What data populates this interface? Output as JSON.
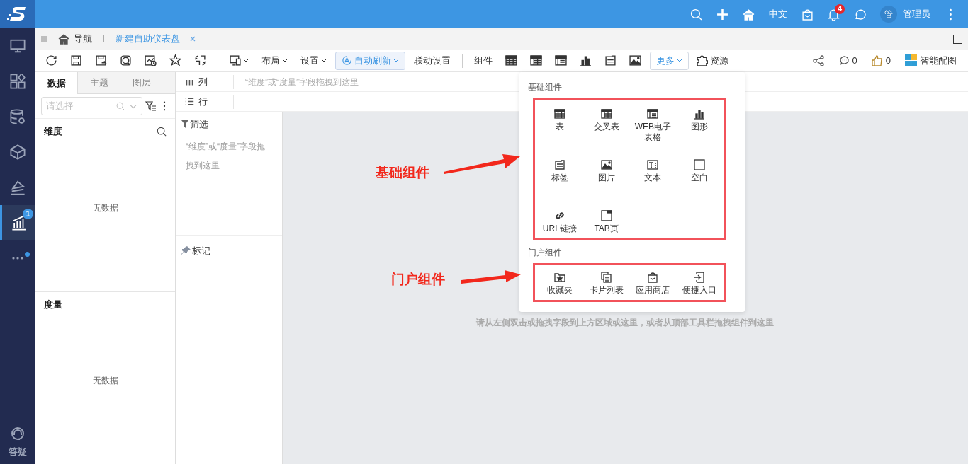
{
  "top_bar": {
    "items": [
      {
        "kind": "icon"
      },
      {
        "kind": "icon"
      },
      {
        "kind": "icon"
      },
      {
        "kind": "text",
        "label": "中文"
      },
      {
        "kind": "icon"
      },
      {
        "kind": "icon",
        "badge": "4"
      },
      {
        "kind": "icon"
      },
      {
        "kind": "avatar",
        "label": "管"
      },
      {
        "kind": "text",
        "label": "管理员"
      },
      {
        "kind": "icon"
      }
    ]
  },
  "sidebar": {
    "items": [
      {
        "selected": false
      },
      {
        "selected": false
      },
      {
        "selected": false
      },
      {
        "selected": false
      },
      {
        "selected": false
      },
      {
        "selected": true,
        "badge": "1"
      },
      {
        "selected": false,
        "dot": true
      }
    ],
    "help": "答疑"
  },
  "tabs": [
    {
      "label": "导航",
      "selected": false,
      "closable": false
    },
    {
      "label": "新建自助仪表盘",
      "selected": true,
      "closable": true
    }
  ],
  "toolbar": {
    "items": [
      {
        "kind": "icon"
      },
      {
        "kind": "icon"
      },
      {
        "kind": "icon"
      },
      {
        "kind": "icon"
      },
      {
        "kind": "icon"
      },
      {
        "kind": "icon"
      },
      {
        "kind": "icon"
      },
      {
        "kind": "separator"
      },
      {
        "kind": "icon-menu"
      },
      {
        "kind": "menu",
        "label": "布局"
      },
      {
        "kind": "menu",
        "label": "设置"
      },
      {
        "kind": "toggle",
        "label": "自动刷新"
      },
      {
        "kind": "text",
        "label": "联动设置"
      },
      {
        "kind": "separator"
      },
      {
        "kind": "text",
        "label": "组件"
      },
      {
        "kind": "icon"
      },
      {
        "kind": "icon"
      },
      {
        "kind": "icon"
      },
      {
        "kind": "icon"
      },
      {
        "kind": "icon"
      },
      {
        "kind": "icon"
      },
      {
        "kind": "more",
        "label": "更多"
      },
      {
        "kind": "icon-text",
        "label": "资源"
      }
    ],
    "right_items": [
      {
        "kind": "icon"
      },
      {
        "kind": "icon-text",
        "label": "0"
      },
      {
        "kind": "icon-text",
        "label": "0"
      },
      {
        "kind": "icon-text",
        "label": "智能配图"
      }
    ]
  },
  "data_panel": {
    "tabs": [
      {
        "label": "数据",
        "selected": true
      },
      {
        "label": "主题",
        "selected": false
      },
      {
        "label": "图层",
        "selected": false
      }
    ],
    "search": {
      "placeholder": "请选择"
    },
    "sections": [
      {
        "title": "维度",
        "empty_text": "无数据"
      },
      {
        "title": "度量",
        "empty_text": "无数据"
      }
    ]
  },
  "shelves": [
    {
      "label": "列",
      "hint": "“维度”或“度量”字段拖拽到这里"
    },
    {
      "label": "行"
    }
  ],
  "filter": {
    "title": "筛选",
    "hint": "“维度”或“度量”字段拖拽到这里"
  },
  "marks": {
    "title": "标记"
  },
  "canvas": {
    "hint": "请从左侧双击或拖拽字段到上方区域或这里，或者从顶部工具栏拖拽组件到这里"
  },
  "component_menu": {
    "sections": [
      {
        "title": "基础组件",
        "items": [
          {
            "label": "表"
          },
          {
            "label": "交叉表"
          },
          {
            "label": "WEB电子表格"
          },
          {
            "label": "图形"
          },
          {
            "label": "标签"
          },
          {
            "label": "图片"
          },
          {
            "label": "文本"
          },
          {
            "label": "空白"
          },
          {
            "label": "URL链接"
          },
          {
            "label": "TAB页"
          }
        ]
      },
      {
        "title": "门户组件",
        "items": [
          {
            "label": "收藏夹"
          },
          {
            "label": "卡片列表"
          },
          {
            "label": "应用商店"
          },
          {
            "label": "便捷入口"
          }
        ]
      }
    ]
  },
  "annotations": [
    {
      "text": "基础组件"
    },
    {
      "text": "门户组件"
    }
  ]
}
